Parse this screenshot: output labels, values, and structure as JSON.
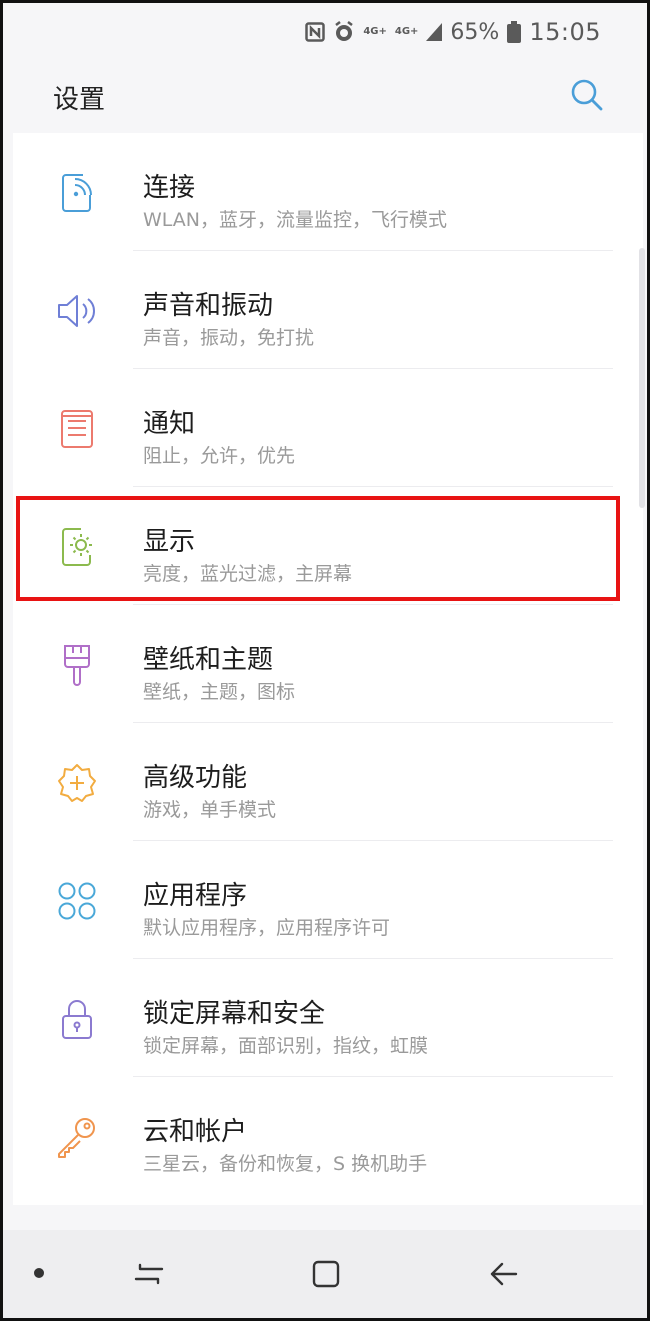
{
  "status_bar": {
    "net1": "4G+",
    "net2": "4G+",
    "battery_pct": "65%",
    "time": "15:05"
  },
  "header": {
    "title": "设置"
  },
  "settings": [
    {
      "title": "连接",
      "subtitle": "WLAN，蓝牙，流量监控，飞行模式",
      "icon": "connections-icon",
      "color": "#4a9ed8"
    },
    {
      "title": "声音和振动",
      "subtitle": "声音，振动，免打扰",
      "icon": "volume-icon",
      "color": "#6f7fd6"
    },
    {
      "title": "通知",
      "subtitle": "阻止，允许，优先",
      "icon": "notifications-icon",
      "color": "#ec7a6e"
    },
    {
      "title": "显示",
      "subtitle": "亮度，蓝光过滤，主屏幕",
      "icon": "display-icon",
      "color": "#8cba4e"
    },
    {
      "title": "壁纸和主题",
      "subtitle": "壁纸，主题，图标",
      "icon": "paint-brush-icon",
      "color": "#b06fc8"
    },
    {
      "title": "高级功能",
      "subtitle": "游戏，单手模式",
      "icon": "gear-plus-icon",
      "color": "#f2ac40"
    },
    {
      "title": "应用程序",
      "subtitle": "默认应用程序，应用程序许可",
      "icon": "apps-icon",
      "color": "#4aa8d8"
    },
    {
      "title": "锁定屏幕和安全",
      "subtitle": "锁定屏幕，面部识别，指纹，虹膜",
      "icon": "lock-icon",
      "color": "#8b7ad0"
    },
    {
      "title": "云和帐户",
      "subtitle": "三星云，备份和恢复，S 换机助手",
      "icon": "key-icon",
      "color": "#f0954e"
    }
  ],
  "colors": {
    "highlight": "#e81313",
    "search": "#4a9ed8"
  }
}
